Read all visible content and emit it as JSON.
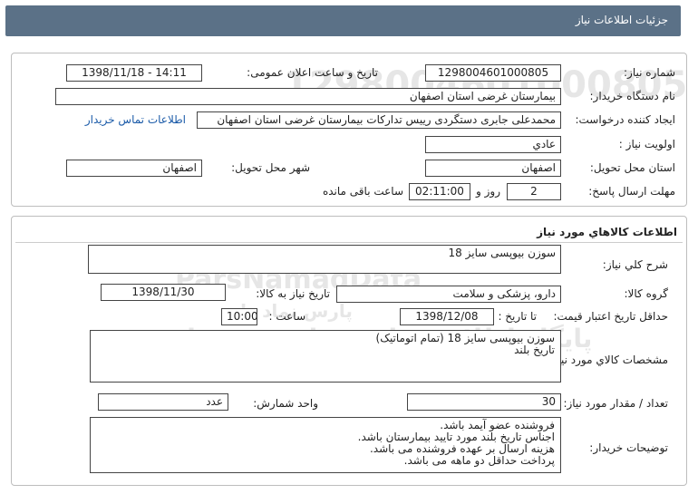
{
  "header": {
    "title": "جزئیات اطلاعات نیاز"
  },
  "info": {
    "need_number_label": "شماره نیاز:",
    "need_number": "1298004601000805",
    "announce_label": "تاریخ و ساعت اعلان عمومی:",
    "announce_value": "1398/11/18 - 14:11",
    "buyer_org_label": "نام دستگاه خریدار:",
    "buyer_org": "بیمارستان غرضی استان اصفهان",
    "creator_label": "ایجاد کننده درخواست:",
    "creator": "محمدعلی جابری دستگردی رییس تدارکات بیمارستان غرضی استان اصفهان",
    "contact_link": "اطلاعات تماس خریدار",
    "priority_label": "اولویت نیاز :",
    "priority": "عادي",
    "province_label": "استان محل تحویل:",
    "province": "اصفهان",
    "city_label": "شهر محل تحویل:",
    "city": "اصفهان",
    "deadline_label": "مهلت ارسال پاسخ:",
    "days": "2",
    "days_unit": "روز و",
    "time_left": "02:11:00",
    "time_left_unit": "ساعت باقی مانده"
  },
  "goods": {
    "section_title": "اطلاعات کالاهاي مورد نياز",
    "general_desc_label": "شرح کلي نياز:",
    "general_desc": "سوزن بیوپسی سایز 18",
    "group_label": "گروه کالا:",
    "group": "دارو، پزشکی و سلامت",
    "need_date_label": "تاریخ نیاز به کالا:",
    "need_date": "1398/11/30",
    "min_validity_label": "حداقل تاریخ اعتبار قیمت:",
    "until_date_label": "تا تاریخ :",
    "until_date": "1398/12/08",
    "hour_label": "ساعت :",
    "hour": "10:00",
    "specs_label": "مشخصات کالاي مورد نياز:",
    "specs_lines": [
      "سوزن بیوپسی سایز 18 (تمام اتوماتیک)",
      "تاریخ بلند"
    ],
    "count_label": "تعداد / مقدار مورد نیاز:",
    "count": "30",
    "unit_label": "واحد شمارش:",
    "unit": "عدد",
    "buyer_notes_label": "توضیحات خریدار:",
    "buyer_notes": [
      "فروشنده عضو آیمد باشد.",
      "اجناس تاریخ بلند مورد تایید بیمارستان باشد.",
      "هزینه ارسال بر عهده فروشنده می باشد.",
      "پرداخت حداقل دو ماهه می باشد."
    ]
  },
  "watermark": {
    "brand": "ParsNamadData",
    "phone": "021-88349670-5",
    "tagline": "پایگاه اطلاع رسانی مناقصه ومزایده",
    "note": "پارس نماد داده"
  }
}
